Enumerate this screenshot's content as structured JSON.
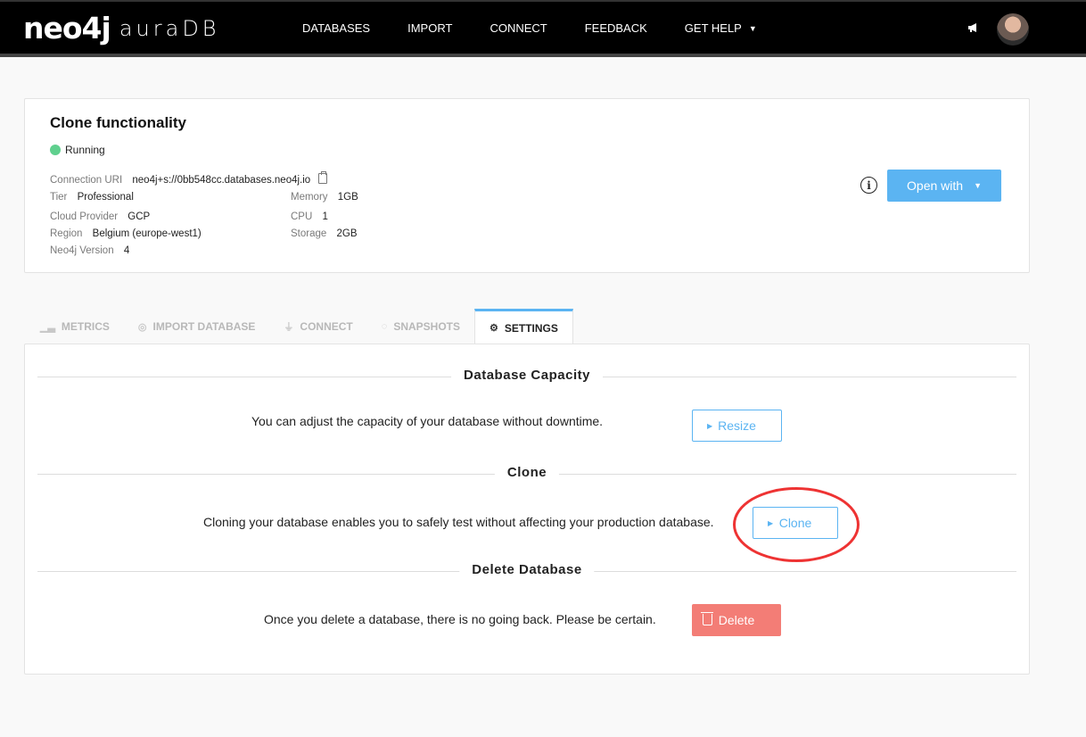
{
  "brand": {
    "name": "neo4j",
    "product": "auraDB"
  },
  "nav": {
    "items": [
      "DATABASES",
      "IMPORT",
      "CONNECT",
      "FEEDBACK"
    ],
    "help_label": "GET HELP"
  },
  "database": {
    "name": "Clone functionality",
    "status": "Running",
    "status_color": "#5fd08e",
    "connection_uri_label": "Connection URI",
    "connection_uri": "neo4j+s://0bb548cc.databases.neo4j.io",
    "tier_label": "Tier",
    "tier": "Professional",
    "cloud_provider_label": "Cloud Provider",
    "cloud_provider": "GCP",
    "region_label": "Region",
    "region": "Belgium (europe-west1)",
    "version_label": "Neo4j Version",
    "version": "4",
    "memory_label": "Memory",
    "memory": "1GB",
    "cpu_label": "CPU",
    "cpu": "1",
    "storage_label": "Storage",
    "storage": "2GB",
    "open_with_label": "Open with"
  },
  "tabs": [
    {
      "label": "METRICS",
      "icon": "chart-icon"
    },
    {
      "label": "IMPORT DATABASE",
      "icon": "import-icon"
    },
    {
      "label": "CONNECT",
      "icon": "plug-icon"
    },
    {
      "label": "SNAPSHOTS",
      "icon": "snapshot-icon"
    },
    {
      "label": "SETTINGS",
      "icon": "gear-icon",
      "active": true
    }
  ],
  "settings": {
    "capacity": {
      "title": "Database Capacity",
      "description": "You can adjust the capacity of your database without downtime.",
      "button": "Resize"
    },
    "clone": {
      "title": "Clone",
      "description": "Cloning your database enables you to safely test without affecting your production database.",
      "button": "Clone"
    },
    "delete": {
      "title": "Delete Database",
      "description": "Once you delete a database, there is no going back. Please be certain.",
      "button": "Delete"
    }
  },
  "colors": {
    "accent": "#5bb4f2",
    "danger": "#f37d76",
    "annotation": "#ee3333"
  }
}
